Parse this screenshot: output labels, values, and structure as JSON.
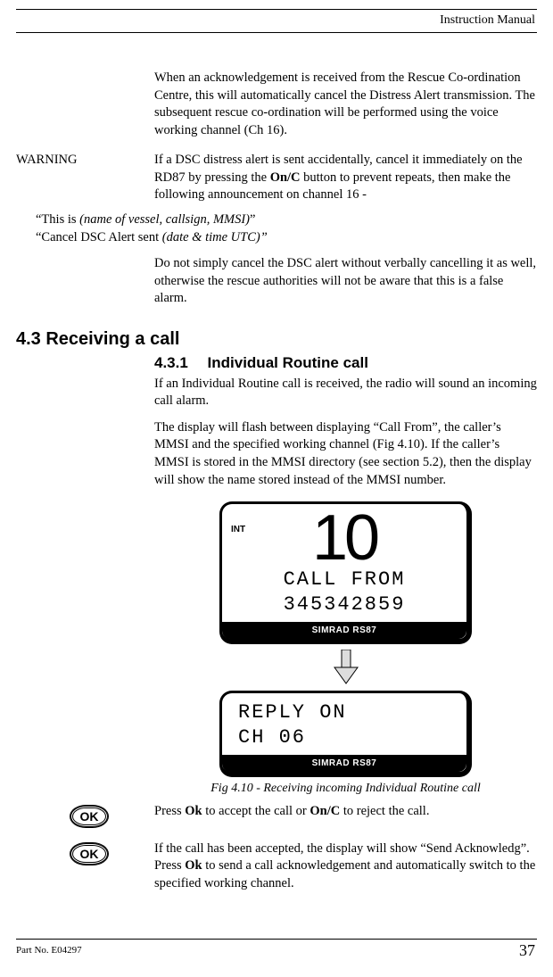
{
  "header": {
    "right": "Instruction Manual"
  },
  "intro": "When an acknowledgement is received from the Rescue Co-ordination Centre, this will automatically cancel the Distress Alert transmission.  The subsequent rescue co-ordination will be performed using the voice working channel (Ch 16).",
  "warning": {
    "label": "WARNING",
    "p1a": "If a DSC distress alert is sent accidentally, cancel it immediately on the  RD87 by pressing the ",
    "p1b": "On/C",
    "p1c": " button to prevent repeats, then make the following announcement on channel 16 -",
    "q1a": "“This is ",
    "q1b": "(name of vessel, callsign, MMSI)",
    "q1c": "”",
    "q2a": "“Cancel DSC Alert sent ",
    "q2b": "(date & time UTC)”",
    "p2": "Do not simply cancel the DSC alert without verbally cancelling it as well, otherwise the rescue authorities will not be aware that this is a false alarm."
  },
  "sec": {
    "h1": "4.3 Receiving a call",
    "h2": "4.3.1  Individual Routine call",
    "p1": "If an Individual Routine call is received, the radio will sound an incoming call alarm.",
    "p2": "The display will flash between displaying “Call From”, the caller’s MMSI and the specified working channel (Fig 4.10).  If the caller’s MMSI is stored in the MMSI directory (see section 5.2), then the display will show the name stored instead of the MMSI number."
  },
  "display1": {
    "int": "INT",
    "channel": "10",
    "line1": "CALL FROM",
    "line2": "345342859",
    "brand": "SIMRAD RS87"
  },
  "display2": {
    "line1": "REPLY ON",
    "line2": "CH 06",
    "brand": "SIMRAD RS87"
  },
  "figcap": "Fig 4.10 - Receiving incoming Individual Routine call",
  "ok_label": "OK",
  "press": {
    "a": "Press ",
    "b": "Ok",
    "c": " to accept the call or ",
    "d": "On/C",
    "e": " to reject the call."
  },
  "accept": {
    "a": "If the call has been accepted, the display will show “Send Acknowledg”.  Press ",
    "b": "Ok",
    "c": " to send a call acknowledgement and automatically switch to the specified working channel."
  },
  "footer": {
    "left": "Part No. E04297",
    "right": "37"
  }
}
